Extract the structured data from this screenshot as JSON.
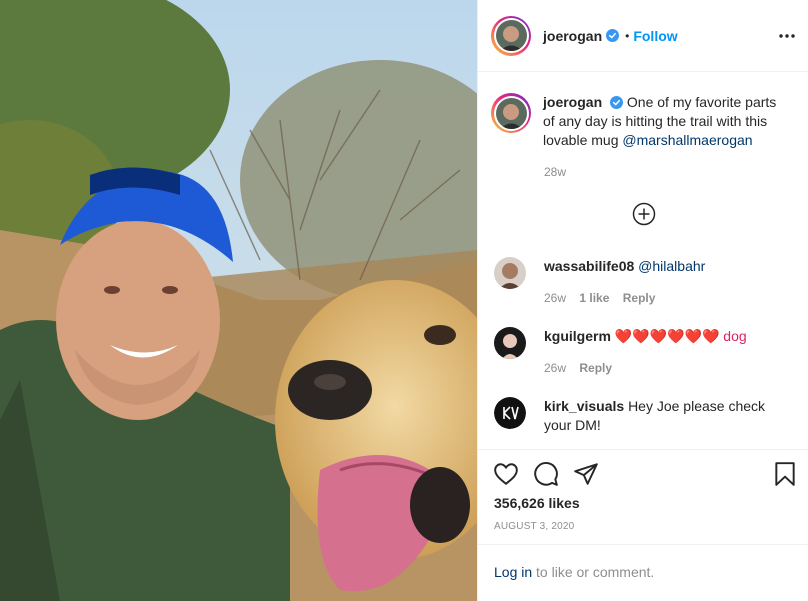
{
  "post": {
    "username": "joerogan",
    "follow_label": "Follow",
    "separator": "•",
    "caption": "One of my favorite parts of any day is hitting the trail with this lovable mug ",
    "caption_mention": "@marshallmaerogan",
    "caption_time": "28w",
    "likes": "356,626 likes",
    "date": "AUGUST 3, 2020"
  },
  "comments": [
    {
      "username": "wassabilife08",
      "text": "@hilalbahr",
      "time": "26w",
      "likes": "1 like",
      "reply": "Reply"
    },
    {
      "username": "kguilgerm",
      "text": "❤️❤️❤️❤️❤️❤️ dog",
      "time": "26w",
      "reply": "Reply"
    },
    {
      "username": "kirk_visuals",
      "text": "Hey Joe please check your DM!"
    }
  ],
  "footer": {
    "login_link": "Log in",
    "login_rest": " to like or comment."
  },
  "colors": {
    "follow_blue": "#0095f6",
    "mention_blue": "#00376b",
    "muted_gray": "#8e8e8e",
    "heart_red": "#e0245e"
  },
  "icons": [
    "more-options-icon",
    "verified-badge-icon",
    "add-comment-icon",
    "heart-icon",
    "comment-icon",
    "share-icon",
    "bookmark-icon"
  ]
}
